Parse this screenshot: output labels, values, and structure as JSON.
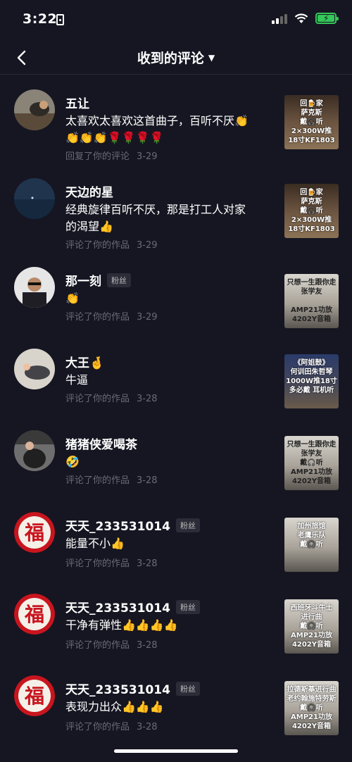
{
  "status": {
    "time": "3:22"
  },
  "nav": {
    "title": "收到的评论"
  },
  "comments": [
    {
      "username": "五让",
      "fan_badge": "",
      "text": "太喜欢太喜欢这首曲子，百听不厌👏👏👏👏🌹🌹🌹🌹",
      "action": "回复了你的评论",
      "date": "3-29",
      "thumb_text": "回🍺家\n萨克斯\n戴🎧听\n2×300W推\n18寸KF1803"
    },
    {
      "username": "天边的星",
      "fan_badge": "",
      "text": "经典旋律百听不厌，那是打工人对家的渴望👍",
      "action": "评论了你的作品",
      "date": "3-29",
      "thumb_text": "回🍺家\n萨克斯\n戴🎧听\n2×300W推\n18寸KF1803"
    },
    {
      "username": "那一刻",
      "fan_badge": "粉丝",
      "text": "👏",
      "action": "评论了你的作品",
      "date": "3-29",
      "thumb_text": "只想一生跟你走\n张学友\n\nAMP21功放\n4202Y音箱"
    },
    {
      "username": "大王🤞",
      "fan_badge": "",
      "text": "牛逼",
      "action": "评论了你的作品",
      "date": "3-28",
      "thumb_text": "《阿姐鼓》\n何训田朱哲琴\n1000W推18寸\n多必戴  耳机听"
    },
    {
      "username": "猪猪侠爱喝茶",
      "fan_badge": "",
      "text": "🤣",
      "action": "评论了你的作品",
      "date": "3-28",
      "thumb_text": "只想一生跟你走\n张学友\n戴🎧听\nAMP21功放\n4202Y音箱"
    },
    {
      "username": "天天_233531014",
      "fan_badge": "粉丝",
      "text": "能量不小👍",
      "action": "评论了你的作品",
      "date": "3-28",
      "thumb_text": "加州旅馆\n老鹰乐队\n戴🎧听"
    },
    {
      "username": "天天_233531014",
      "fan_badge": "粉丝",
      "text": "干净有弹性👍👍👍👍",
      "action": "评论了你的作品",
      "date": "3-28",
      "thumb_text": "西班牙斗牛士\n进行曲\n戴🎧听\nAMP21功放\n4202Y音箱"
    },
    {
      "username": "天天_233531014",
      "fan_badge": "粉丝",
      "text": "表现力出众👍👍👍",
      "action": "评论了你的作品",
      "date": "3-28",
      "thumb_text": "拉德斯基进行曲\n老约翰施特劳斯\n戴🎧听\nAMP21功放\n4202Y音箱"
    }
  ]
}
